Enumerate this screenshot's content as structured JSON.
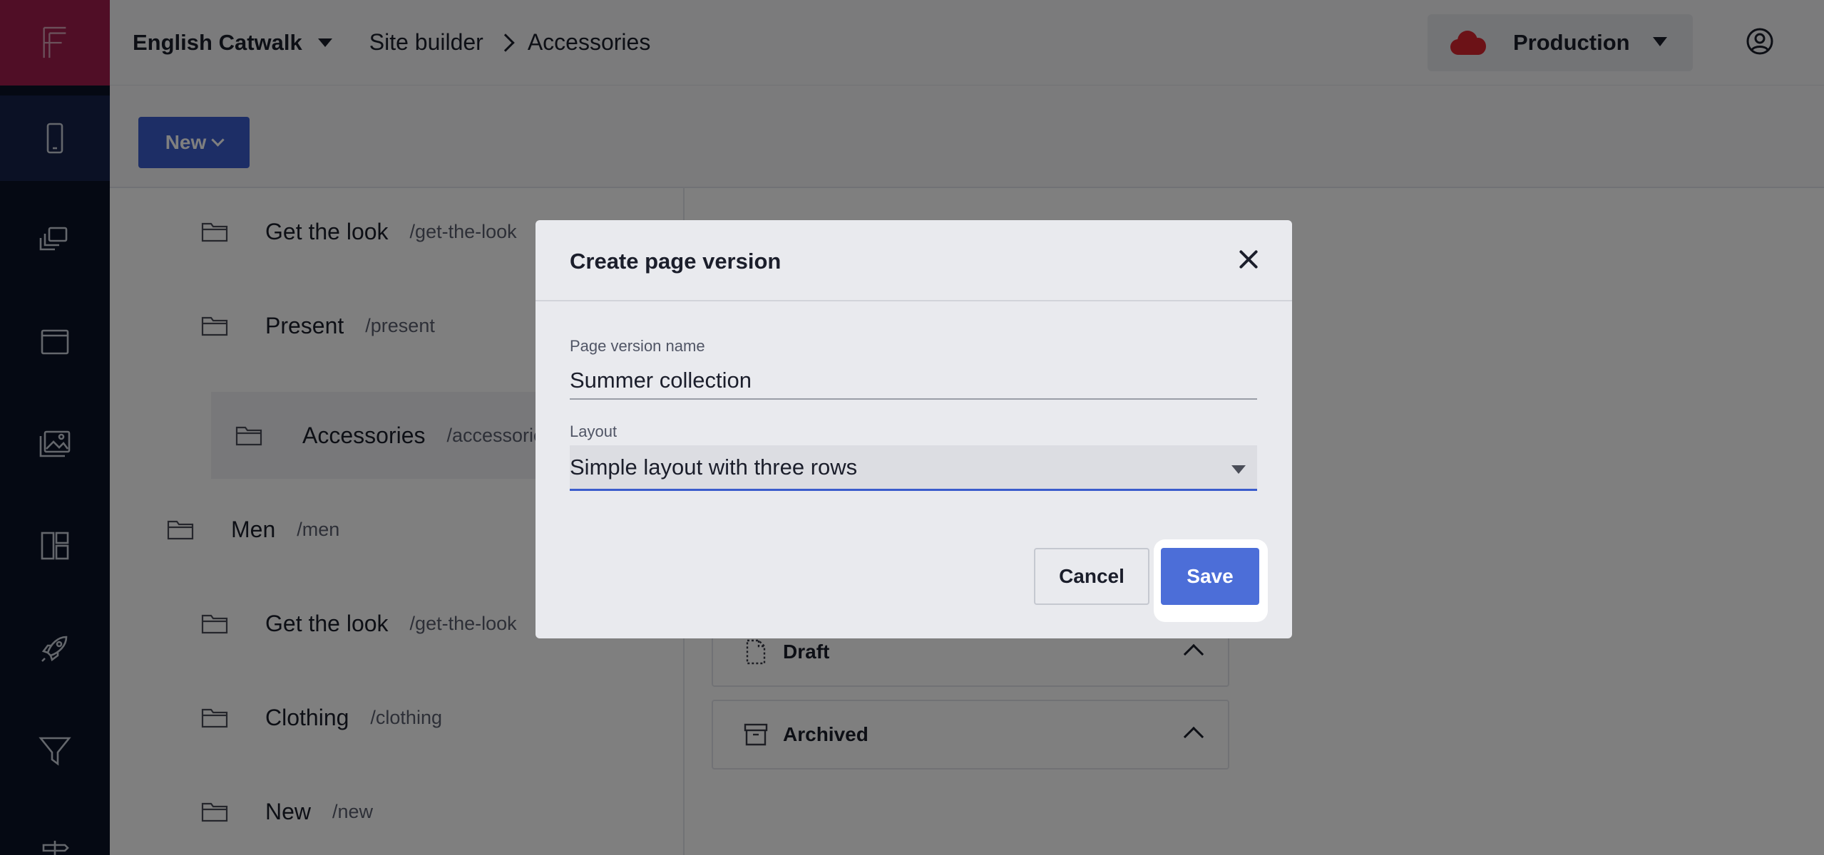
{
  "rail": {
    "items": [
      "device-icon",
      "pages-icon",
      "window-icon",
      "media-icon",
      "layout-icon",
      "rocket-icon",
      "filter-icon"
    ]
  },
  "topbar": {
    "site_name": "English Catwalk",
    "crumb_1": "Site builder",
    "crumb_2": "Accessories",
    "environment": "Production"
  },
  "toolbar": {
    "new_label": "New"
  },
  "tree": {
    "items": [
      {
        "name": "Get the look",
        "slug": "/get-the-look"
      },
      {
        "name": "Present",
        "slug": "/present"
      },
      {
        "name": "Accessories",
        "slug": "/accessories"
      },
      {
        "name": "Men",
        "slug": "/men"
      },
      {
        "name": "Get the look",
        "slug": "/get-the-look"
      },
      {
        "name": "Clothing",
        "slug": "/clothing"
      },
      {
        "name": "New",
        "slug": "/new"
      }
    ]
  },
  "panels": {
    "draft": "Draft",
    "archived": "Archived"
  },
  "dialog": {
    "title": "Create page version",
    "name_label": "Page version name",
    "name_value": "Summer collection",
    "layout_label": "Layout",
    "layout_value": "Simple layout with three rows",
    "cancel_label": "Cancel",
    "save_label": "Save"
  },
  "colors": {
    "accent": "#3a5ccc",
    "rail_bg": "#0b1326",
    "logo_bg": "#a01d4c",
    "env_cloud": "#d9252f"
  }
}
